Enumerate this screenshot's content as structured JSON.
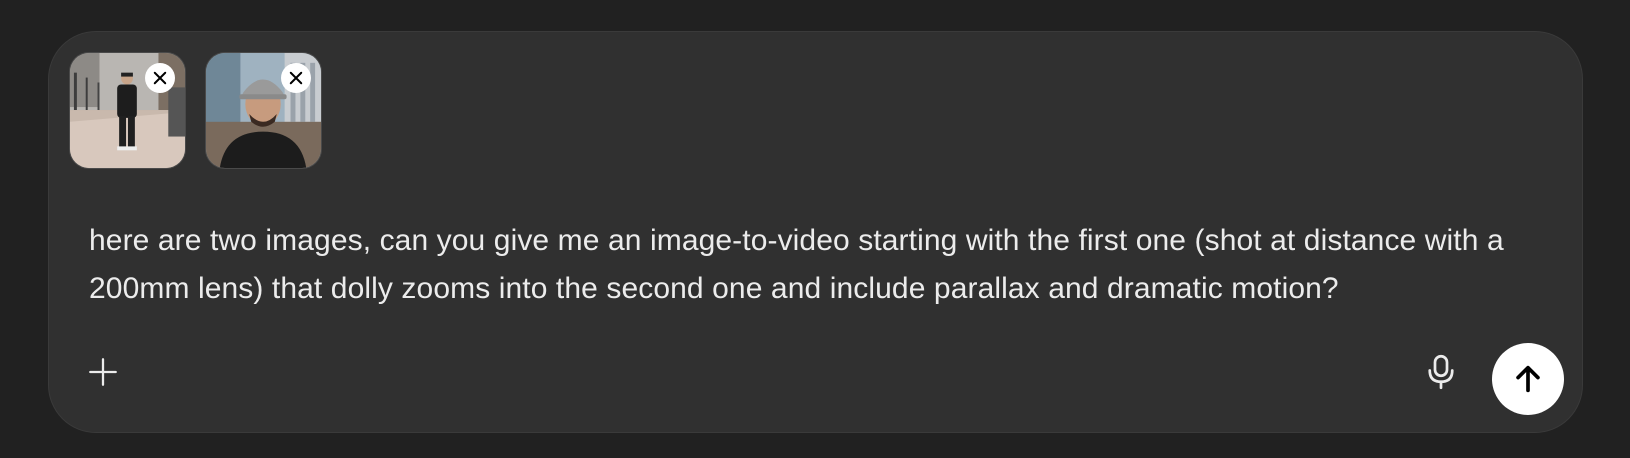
{
  "composer": {
    "attachments": [
      {
        "alt": "",
        "remove_icon": "close-icon"
      },
      {
        "alt": "",
        "remove_icon": "close-icon"
      }
    ],
    "prompt_text": "here are two images, can you give me an image-to-video starting with the first one (shot at distance with a 200mm lens) that dolly zooms into the second one and include parallax and dramatic motion?",
    "add_icon": "plus-icon",
    "mic_icon": "microphone-icon",
    "send_icon": "arrow-up-icon"
  },
  "colors": {
    "background": "#212121",
    "composer_bg": "#303030",
    "text": "#ececec",
    "send_button_bg": "#ffffff"
  }
}
